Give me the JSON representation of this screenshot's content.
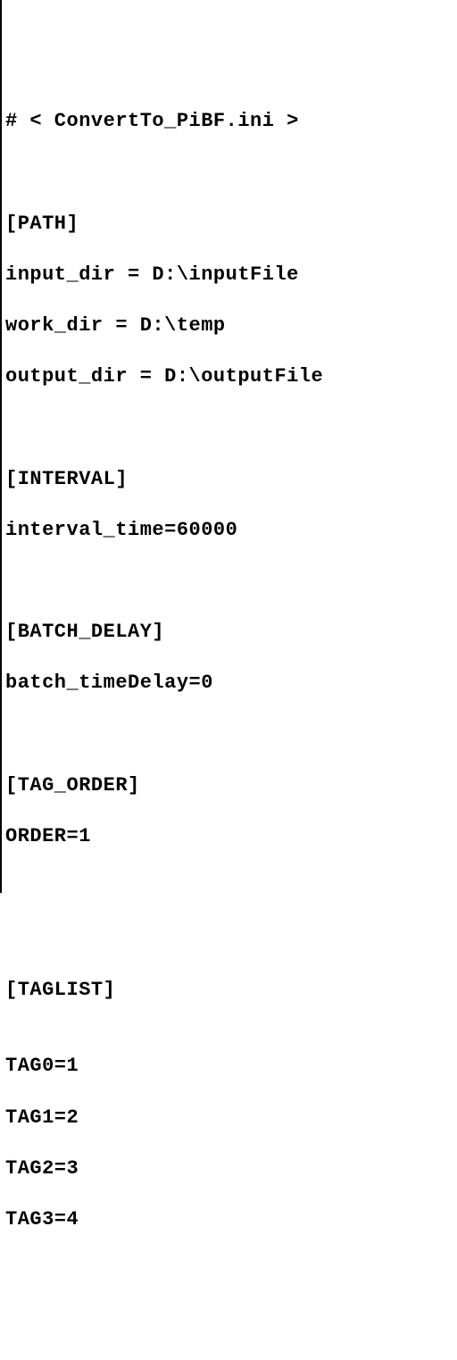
{
  "header": "# < ConvertTo_PiBF.ini >",
  "sections": {
    "path": {
      "title": "[PATH]",
      "lines": [
        "input_dir = D:\\inputFile",
        "work_dir = D:\\temp",
        "output_dir = D:\\outputFile"
      ]
    },
    "interval": {
      "title": "[INTERVAL]",
      "lines": [
        "interval_time=60000"
      ]
    },
    "batch_delay": {
      "title": "[BATCH_DELAY]",
      "lines": [
        "batch_timeDelay=0"
      ]
    },
    "tag_order": {
      "title": "[TAG_ORDER]",
      "lines": [
        "ORDER=1"
      ]
    },
    "taglist": {
      "title": "[TAGLIST]",
      "lines": [
        "TAG0=1",
        "TAG1=2",
        "TAG2=3",
        "TAG3=4"
      ]
    }
  }
}
